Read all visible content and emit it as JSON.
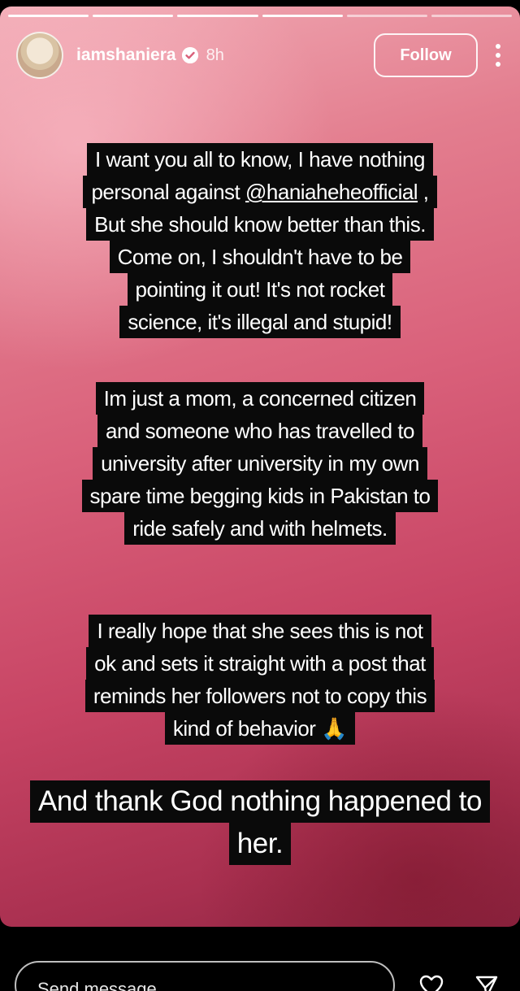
{
  "header": {
    "username": "iamshaniera",
    "time": "8h",
    "follow_label": "Follow"
  },
  "caption1": {
    "line1": "I want you all to know, I have nothing",
    "line2_prefix": "personal against ",
    "mention": "@haniaheheofficial",
    "line2_suffix": " ,",
    "line3": "But she should know better than this.",
    "line4": "Come on, I shouldn't have to be",
    "line5": "pointing it out! It's not rocket",
    "line6": "science, it's illegal and stupid!"
  },
  "caption2": {
    "line1": "Im just a mom, a concerned citizen",
    "line2": "and someone who has travelled to",
    "line3": "university after university in my own",
    "line4": "spare time begging kids in Pakistan to",
    "line5": "ride safely and with helmets."
  },
  "caption3": {
    "line1": "I really hope that she sees this is not",
    "line2": "ok and sets it straight with a post that",
    "line3": "reminds her followers not to copy this",
    "line4": "kind of behavior",
    "emoji": "🙏"
  },
  "caption4": {
    "line1": "And thank God nothing happened to",
    "line2": "her."
  },
  "footer": {
    "message_placeholder": "Send message"
  },
  "icons": {
    "verified": "verified-badge-icon",
    "more": "more-options-icon",
    "heart": "heart-icon",
    "send": "send-icon"
  }
}
